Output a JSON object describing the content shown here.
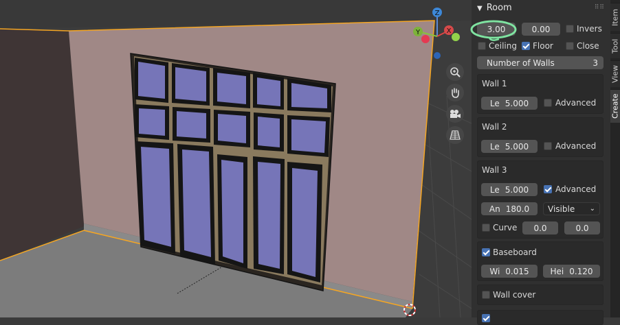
{
  "viewport": {
    "gizmo": {
      "z": "Z",
      "y": "Y",
      "x": "X"
    },
    "nav_icons": [
      "zoom-icon",
      "hand-pan-icon",
      "camera-icon",
      "grid-perspective-icon"
    ]
  },
  "panel": {
    "title": "Room",
    "height_value": "3.00",
    "offset_value": "0.00",
    "invers_label": "Invers",
    "ceiling_label": "Ceiling",
    "floor_label": "Floor",
    "close_label": "Close",
    "walls_count_label": "Number of Walls",
    "walls_count_value": "3",
    "walls": [
      {
        "title": "Wall 1",
        "length_prefix": "Le",
        "length_value": "5.000",
        "advanced_label": "Advanced",
        "advanced": false
      },
      {
        "title": "Wall 2",
        "length_prefix": "Le",
        "length_value": "5.000",
        "advanced_label": "Advanced",
        "advanced": false
      },
      {
        "title": "Wall 3",
        "length_prefix": "Le",
        "length_value": "5.000",
        "advanced_label": "Advanced",
        "advanced": true,
        "angle_prefix": "An",
        "angle_value": "180.0",
        "visibility": "Visible",
        "curve_label": "Curve",
        "curve_a": "0.0",
        "curve_b": "0.0"
      }
    ],
    "baseboard": {
      "label": "Baseboard",
      "checked": true,
      "width_prefix": "Wi",
      "width_value": "0.015",
      "height_prefix": "Hei",
      "height_value": "0.120"
    },
    "wall_cover_label": "Wall cover"
  },
  "tabs": [
    "Item",
    "Tool",
    "View",
    "Create"
  ],
  "colors": {
    "accent": "#4772b3",
    "selection": "#f5a623",
    "highlight": "#7fe3a1"
  }
}
